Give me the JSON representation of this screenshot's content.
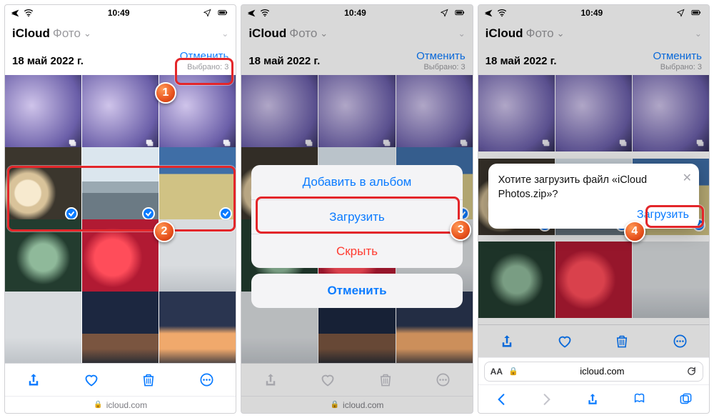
{
  "status_time": "10:49",
  "header": {
    "title": "iCloud",
    "section": "Фото"
  },
  "date": "18 май 2022 г.",
  "cancel_label": "Отменить",
  "selected_label": "Выбрано: 3",
  "safari_domain": "icloud.com",
  "action_sheet": {
    "add_to_album": "Добавить в альбом",
    "download": "Загрузить",
    "hide": "Скрыть",
    "cancel": "Отменить"
  },
  "download_prompt": {
    "message": "Хотите загрузить файл «iCloud Photos.zip»?",
    "action": "Загрузить"
  },
  "badges": {
    "b1": "1",
    "b2": "2",
    "b3": "3",
    "b4": "4"
  },
  "colors": {
    "accent": "#0a7bff",
    "highlight": "#e3262a"
  }
}
